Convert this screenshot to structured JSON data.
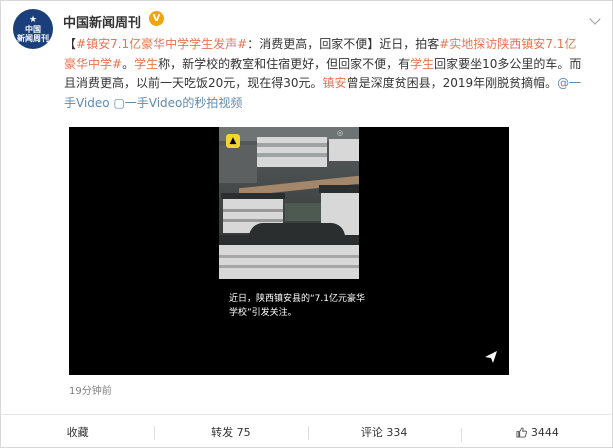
{
  "post": {
    "account_name": "中国新闻周刊",
    "avatar_text": [
      "中国",
      "新闻周刊"
    ],
    "text_segments": [
      {
        "text": "【",
        "style": "plain"
      },
      {
        "text": "#镇安7.1亿豪华中学学生发声#",
        "style": "hl"
      },
      {
        "text": "：消费更高，回家不便】近日，拍客",
        "style": "plain"
      },
      {
        "text": "#实地探访陕西",
        "style": "hl"
      },
      {
        "text": "镇安",
        "style": "link"
      },
      {
        "text": "7.1亿豪华中学#",
        "style": "hl"
      },
      {
        "text": "。",
        "style": "plain"
      },
      {
        "text": "学生",
        "style": "link"
      },
      {
        "text": "称，新学校的教室和住宿更好，但回家不便，有",
        "style": "plain"
      },
      {
        "text": "学生",
        "style": "link"
      },
      {
        "text": "回家要坐10多公里的车。而且消费更高，以前一天吃饭20元，现在得30元。",
        "style": "plain"
      },
      {
        "text": "镇安",
        "style": "link"
      },
      {
        "text": "曾是深度贫困县，2019年刚脱贫摘帽。",
        "style": "plain"
      },
      {
        "text": "@一手Video",
        "style": "at"
      },
      {
        "text": " ▢一手Video的秒拍视频",
        "style": "at"
      }
    ],
    "video_caption": "近日，陕西镇安县的“7.1亿元豪华学校”引发关注。",
    "timestamp": "19分钟前"
  },
  "actions": {
    "favorite": "收藏",
    "repost": "转发 75",
    "comment": "评论 334",
    "like": "3444"
  },
  "colors": {
    "topic": "#eb7350",
    "mention": "#5d8bb2",
    "verified_badge": "#f2a40c",
    "avatar_bg": "#1a3f7a"
  },
  "icons": [
    "verified-icon",
    "chevron-down-icon",
    "video-link-icon",
    "send-icon",
    "thumbs-up-icon",
    "scenic-spot-badge-icon"
  ]
}
